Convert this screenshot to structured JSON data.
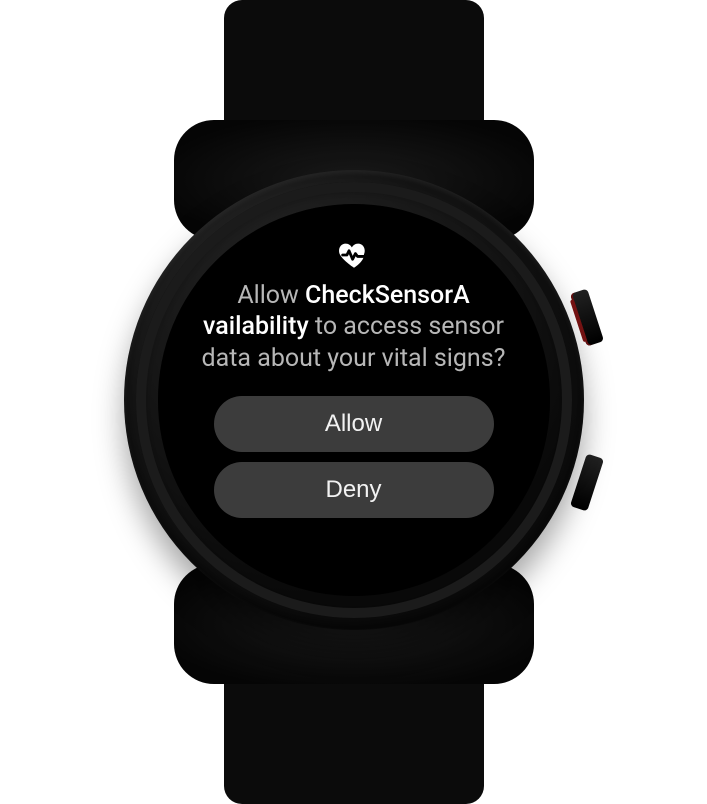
{
  "dialog": {
    "icon": "heart-rate-icon",
    "prompt_prefix": "Allow ",
    "app_name_line1": "CheckSensorA",
    "app_name_line2": "vailability",
    "prompt_mid": " to access sensor data about your vital signs?",
    "allow_label": "Allow",
    "deny_label": "Deny"
  }
}
